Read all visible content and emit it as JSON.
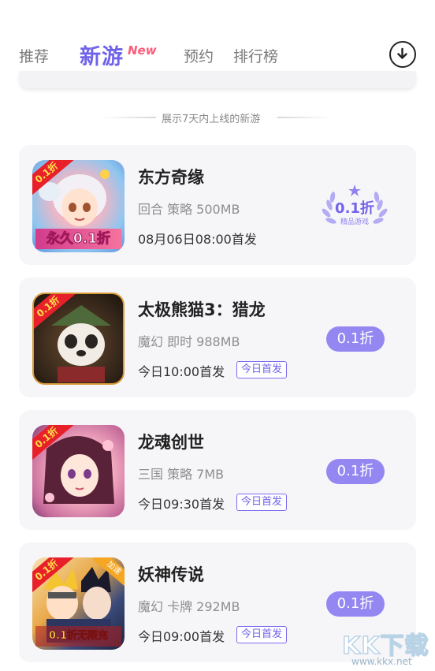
{
  "nav": {
    "tabs": [
      {
        "label": "推荐"
      },
      {
        "label": "新游",
        "badge": "New"
      },
      {
        "label": "预约"
      },
      {
        "label": "排行榜"
      }
    ],
    "download_icon": "download-circle-icon"
  },
  "section_hint": "展示7天内上线的新游",
  "games": [
    {
      "name": "东方奇缘",
      "meta": "回合 策略 500MB",
      "time": "08月06日08:00首发",
      "discount": "0.1折",
      "badge_sub": "精品游戏",
      "icon_ribbon": "0.1折",
      "icon_banner": "永久0.1折"
    },
    {
      "name": "太极熊猫3：猎龙",
      "meta": "魔幻 即时 988MB",
      "time": "今日10:00首发",
      "tag": "今日首发",
      "discount": "0.1折",
      "icon_ribbon": "0.1折"
    },
    {
      "name": "龙魂创世",
      "meta": "三国 策略 7MB",
      "time": "今日09:30首发",
      "tag": "今日首发",
      "discount": "0.1折",
      "icon_ribbon": "0.1折"
    },
    {
      "name": "妖神传说",
      "meta": "魔幻 卡牌 292MB",
      "time": "今日09:00首发",
      "tag": "今日首发",
      "discount": "0.1折",
      "icon_ribbon": "0.1折",
      "icon_corner": "加速",
      "icon_banner": "0.1折无限充"
    }
  ],
  "watermark": {
    "text": "KK下载",
    "url": "www.kkx.net"
  },
  "colors": {
    "accent": "#6f63ea",
    "pill": "#9587f2",
    "card_bg": "#f6f6f9",
    "new_badge": "#ff5a78"
  }
}
